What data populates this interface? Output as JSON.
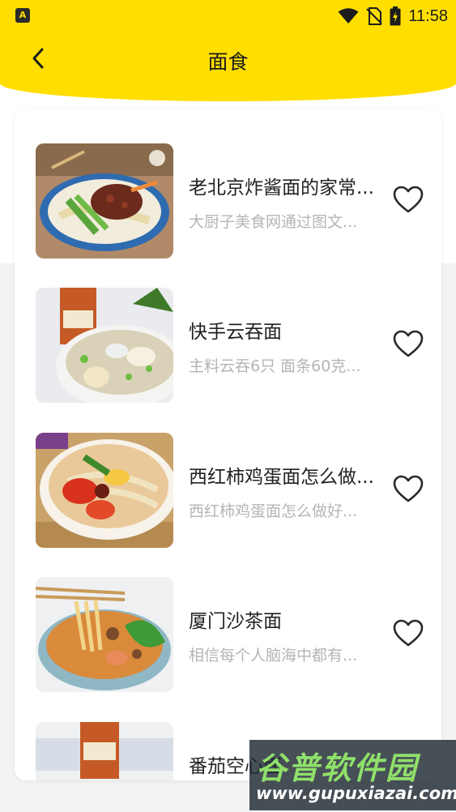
{
  "status_bar": {
    "time": "11:58",
    "left_icon": "A",
    "icons": [
      "wifi-icon",
      "no-sim-icon",
      "battery-charging-icon"
    ]
  },
  "header": {
    "title": "面食",
    "back_icon": "chevron-left-icon"
  },
  "colors": {
    "accent": "#FFDE00",
    "title_text": "#222222",
    "desc_text": "#B5B5B5"
  },
  "recipes": [
    {
      "title": "老北京炸酱面的家常...",
      "desc": "大厨子美食网通过图文...",
      "favorite_icon": "heart-outline-icon"
    },
    {
      "title": "快手云吞面",
      "desc": "主料云吞6只 面条60克...",
      "favorite_icon": "heart-outline-icon"
    },
    {
      "title": "西红柿鸡蛋面怎么做...",
      "desc": "西红柿鸡蛋面怎么做好...",
      "favorite_icon": "heart-outline-icon"
    },
    {
      "title": "厦门沙茶面",
      "desc": "相信每个人脑海中都有...",
      "favorite_icon": "heart-outline-icon"
    },
    {
      "title": "番茄空心面",
      "desc": "",
      "favorite_icon": "heart-outline-icon"
    }
  ],
  "watermark": {
    "name": "谷普软件园",
    "url": "www.gupuxiazai.com"
  }
}
